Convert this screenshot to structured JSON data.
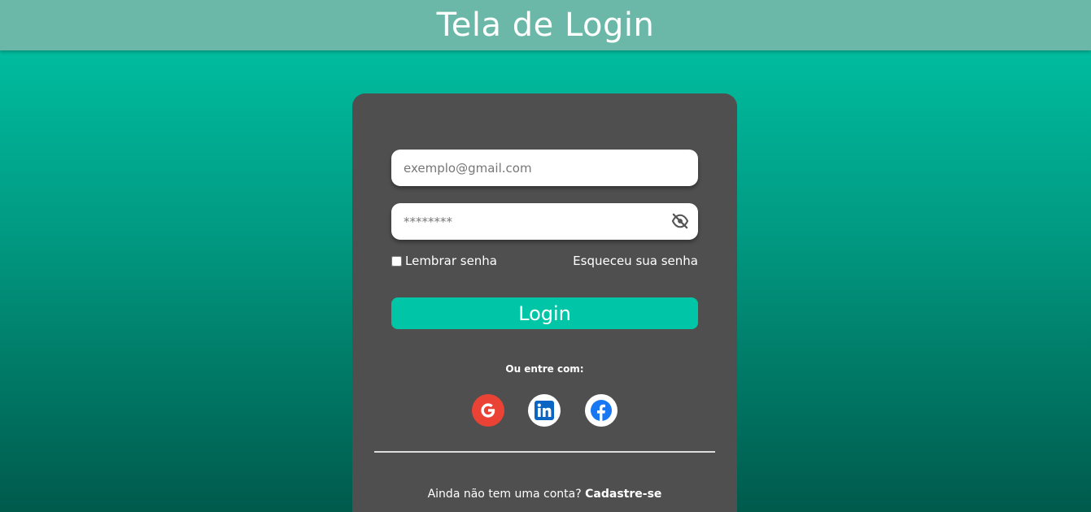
{
  "header": {
    "title": "Tela de Login"
  },
  "form": {
    "email_placeholder": "exemplo@gmail.com",
    "password_placeholder": "********",
    "password_toggle_icon": "eye-slash-icon",
    "remember_label": "Lembrar senha",
    "forgot_label": "Esqueceu sua senha",
    "login_label": "Login"
  },
  "social": {
    "label": "Ou entre com:",
    "providers": [
      {
        "name": "google",
        "icon": "google-icon",
        "color": "#ea4335"
      },
      {
        "name": "linkedin",
        "icon": "linkedin-icon",
        "color": "#0a66c2"
      },
      {
        "name": "facebook",
        "icon": "facebook-icon",
        "color": "#1877f2"
      }
    ]
  },
  "signup": {
    "prompt": "Ainda não tem uma conta?",
    "link": "Cadastre-se"
  },
  "colors": {
    "accent": "#00c6a7",
    "header_bg": "#6bb8a8",
    "card_bg": "#4f4f4f"
  }
}
